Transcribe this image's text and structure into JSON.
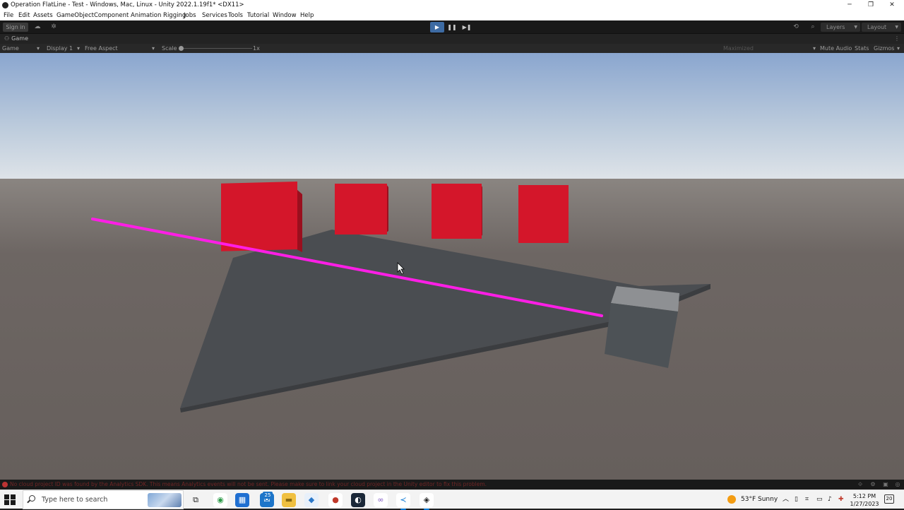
{
  "window": {
    "title": "Operation FlatLine - Test - Windows, Mac, Linux - Unity 2022.1.19f1* <DX11>",
    "controls": [
      "─",
      "❐",
      "✕"
    ]
  },
  "menu": [
    "File",
    "Edit",
    "Assets",
    "GameObject",
    "Component",
    "Animation Rigging",
    "Jobs",
    "Services",
    "Tools",
    "Tutorial",
    "Window",
    "Help"
  ],
  "toolbar": {
    "sign_in": "Sign in",
    "cloud_icon": "cloud-icon",
    "collab_icon": "collab-icon",
    "play_icon": "▶",
    "pause_icon": "❚❚",
    "step_icon": "▶❚",
    "history_icon": "⟲",
    "search_icon": "⌕",
    "layers": "Layers",
    "layout": "Layout"
  },
  "tab": {
    "label": "Game",
    "menu_icon": "⋮"
  },
  "game_toolbar": {
    "mode": "Game",
    "display": "Display 1",
    "aspect": "Free Aspect",
    "scale_label": "Scale",
    "scale_value": "1x",
    "maximized": "Maximized",
    "mute_audio": "Mute Audio",
    "stats": "Stats",
    "gizmos": "Gizmos"
  },
  "status": {
    "message": "No cloud project ID was found by the Analytics SDK. This means Analytics events will not be sent. Please make sure to link your cloud project in the Unity editor to fix this problem."
  },
  "taskbar": {
    "search_placeholder": "Type here to search",
    "weather": "53°F  Sunny",
    "time": "5:12 PM",
    "date": "1/27/2023",
    "mail_badge": "25",
    "notification_count": "20",
    "apps": [
      {
        "name": "task-view-icon",
        "glyph": "⧉",
        "color": "#f3f3f3",
        "fg": "#222"
      },
      {
        "name": "chrome-icon",
        "glyph": "◉",
        "color": "#ffffff",
        "fg": "#2b9a47"
      },
      {
        "name": "store-icon",
        "glyph": "▦",
        "color": "#1f6fd1",
        "fg": "#fff"
      },
      {
        "name": "mail-icon",
        "glyph": "✉",
        "color": "#1d75c9",
        "fg": "#fff"
      },
      {
        "name": "file-explorer-icon",
        "glyph": "▬",
        "color": "#f0c040",
        "fg": "#8a6a10"
      },
      {
        "name": "app-blue-icon",
        "glyph": "◆",
        "color": "#e8f0fa",
        "fg": "#2a77c9"
      },
      {
        "name": "recorder-icon",
        "glyph": "●",
        "color": "#ffffff",
        "fg": "#c0392b"
      },
      {
        "name": "steam-icon",
        "glyph": "◐",
        "color": "#1b2838",
        "fg": "#fff"
      },
      {
        "name": "visual-studio-icon",
        "glyph": "∞",
        "color": "#ffffff",
        "fg": "#7e57c2"
      },
      {
        "name": "vscode-icon",
        "glyph": "≺",
        "color": "#ffffff",
        "fg": "#0a78d4"
      },
      {
        "name": "unity-icon",
        "glyph": "◈",
        "color": "#ffffff",
        "fg": "#222"
      }
    ]
  },
  "colors": {
    "accent_play": "#3d6ba3",
    "cube_red": "#d4162a",
    "laser": "#ff1ee6",
    "ground": "#6b6461",
    "platform": "#4a4d51"
  }
}
